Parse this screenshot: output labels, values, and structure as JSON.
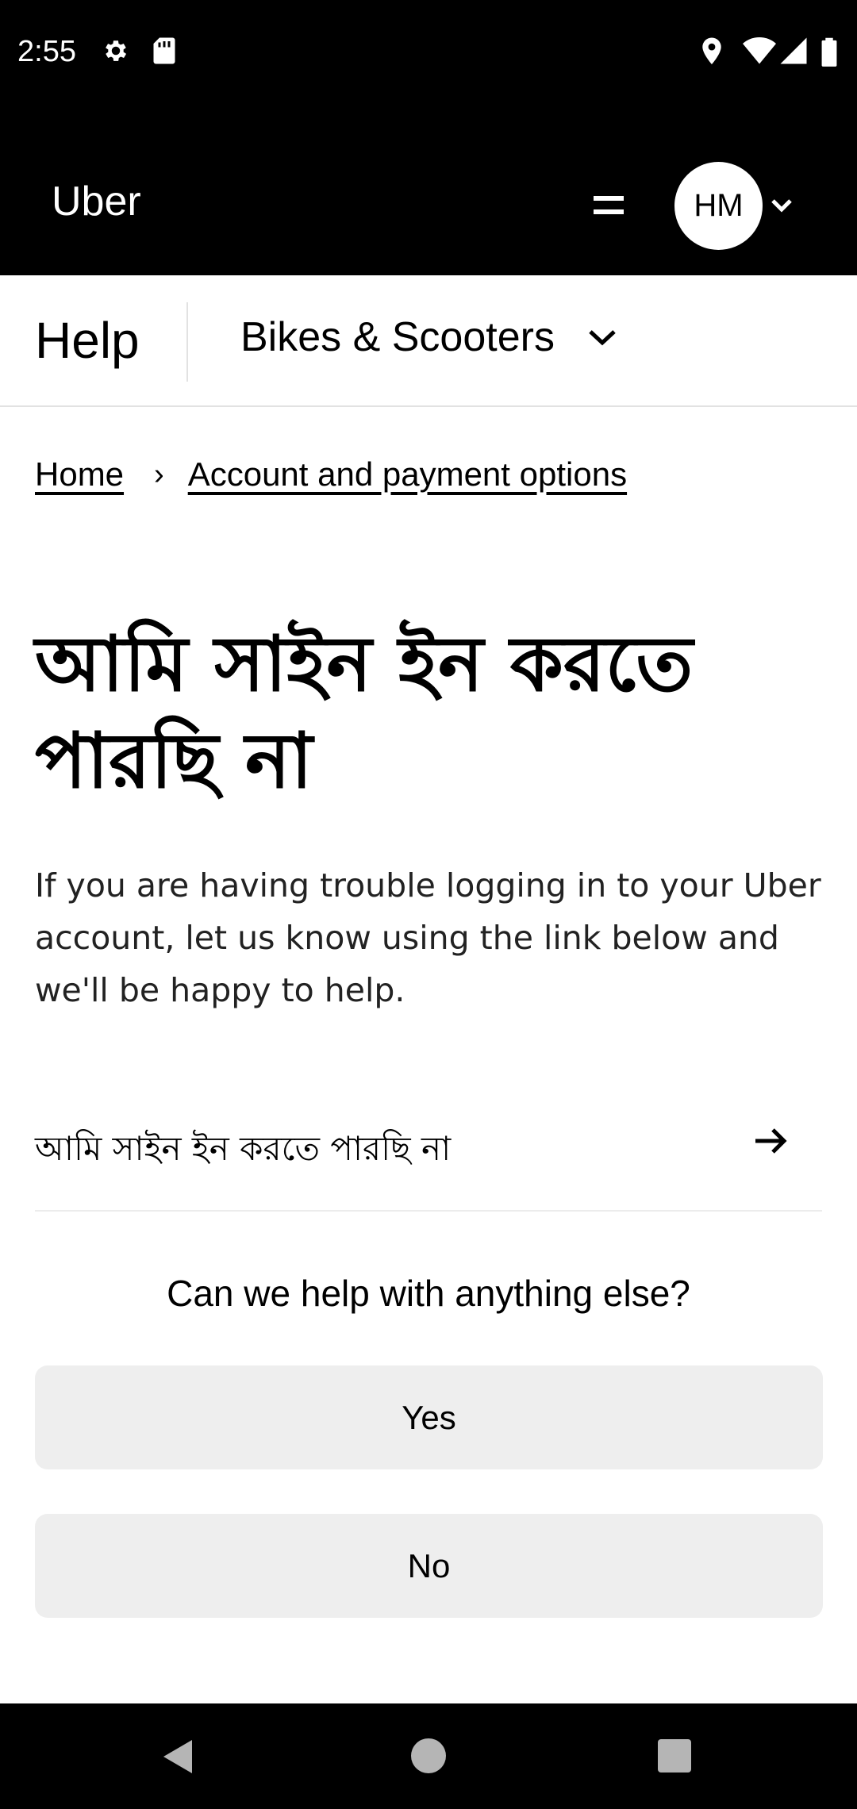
{
  "status_bar": {
    "time": "2:55",
    "left_icons": [
      "gear-icon",
      "sd-card-icon"
    ],
    "right_icons": [
      "location-icon",
      "wifi-icon",
      "signal-icon",
      "battery-icon"
    ]
  },
  "header": {
    "brand": "Uber",
    "menu_icon": "hamburger-menu-icon",
    "avatar_initials": "HM"
  },
  "help_bar": {
    "title": "Help",
    "category": "Bikes & Scooters"
  },
  "breadcrumb": {
    "items": [
      "Home",
      "Account and payment options"
    ],
    "separator": "›"
  },
  "article": {
    "title": "আমি সাইন ইন করতে পারছি না",
    "description": "If you are having trouble logging in to your Uber account, let us know using the link below and we'll be happy to help.",
    "link_label": "আমি সাইন ইন করতে পারছি না"
  },
  "followup": {
    "question": "Can we help with anything else?",
    "yes_label": "Yes",
    "no_label": "No"
  },
  "colors": {
    "header_bg": "#000000",
    "button_bg": "#eeeeee",
    "divider": "#e2e2e2"
  }
}
